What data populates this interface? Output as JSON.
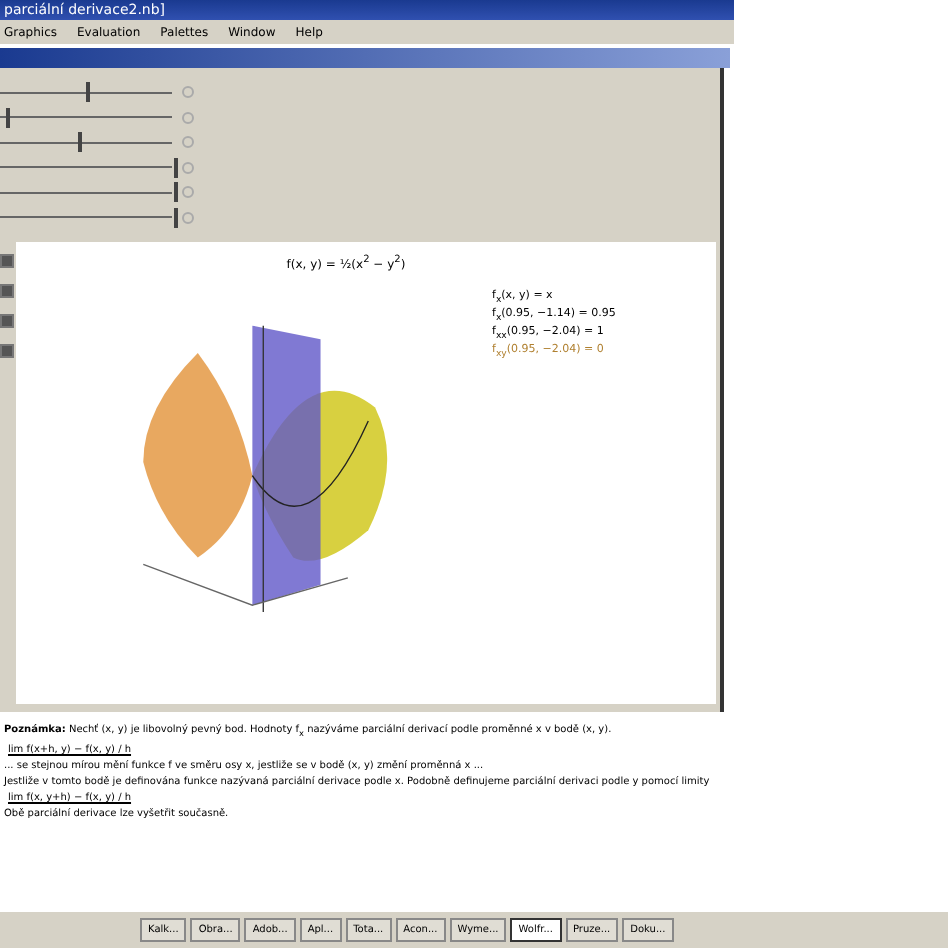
{
  "window": {
    "title": "parciální derivace2.nb]"
  },
  "menu": [
    "Graphics",
    "Evaluation",
    "Palettes",
    "Window",
    "Help"
  ],
  "sliders": [
    {
      "level": 0.5
    },
    {
      "level": 0.05
    },
    {
      "level": 0.46
    },
    {
      "level": 1
    },
    {
      "level": 1
    },
    {
      "level": 1
    }
  ],
  "checkboxes": [
    {
      "checked": true
    },
    {
      "checked": true
    },
    {
      "checked": true
    },
    {
      "checked": true
    }
  ],
  "plot": {
    "formula": "f(x, y) = ½(x$^{2}$ − y$^{2}$)",
    "legend": [
      "f$_{x}$(x, y) = x",
      "f$_{x}$(0.95, −1.14) = 0.95",
      "f$_{xx}$(0.95, −2.04) = 1",
      "f$_{xy}$(0.95, −2.04) = 0"
    ]
  },
  "paragraphs": [
    {
      "kind": "note",
      "text": "**Poznámka:** Nechť (x, y) je libovolný pevný bod. Hodnoty f$_{x}$ nazýváme parciální derivací podle proměnné x v bodě (x, y)."
    },
    {
      "kind": "formula",
      "text": "lim f(x+h, y) − f(x, y) / h"
    },
    {
      "kind": "text",
      "text": "... se stejnou mírou mění funkce f ve směru osy x, jestliže se v bodě (x, y) změní proměnná x ..."
    },
    {
      "kind": "text",
      "text": "Jestliže v tomto bodě je definována funkce nazývaná parciální derivace podle x. Podobně definujeme parciální derivaci podle y pomocí limity"
    },
    {
      "kind": "formula",
      "text": "lim f(x, y+h) − f(x, y) / h"
    },
    {
      "kind": "text",
      "text": "Obě parciální derivace lze vyšetřit současně."
    }
  ],
  "taskbar": [
    {
      "label": "Kalk...",
      "selected": false
    },
    {
      "label": "Obra...",
      "selected": false
    },
    {
      "label": "Adob...",
      "selected": false
    },
    {
      "label": "Apl...",
      "selected": false
    },
    {
      "label": "Tota...",
      "selected": false
    },
    {
      "label": "Acon...",
      "selected": false
    },
    {
      "label": "Wyme...",
      "selected": false
    },
    {
      "label": "Wolfr...",
      "selected": true
    },
    {
      "label": "Pruze...",
      "selected": false
    },
    {
      "label": "Doku...",
      "selected": false
    }
  ]
}
